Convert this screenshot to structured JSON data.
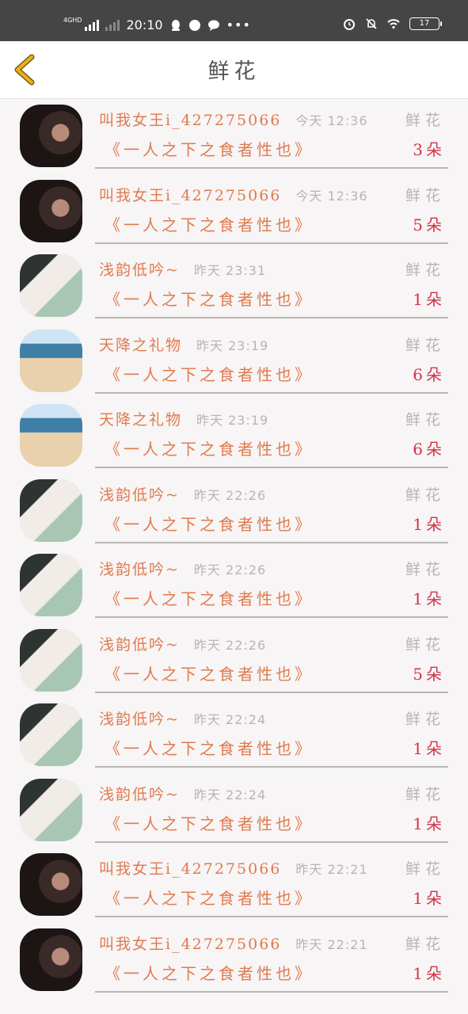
{
  "status_bar": {
    "network": "4GHD",
    "time": "20:10",
    "battery": "17"
  },
  "header": {
    "title": "鲜花"
  },
  "records": [
    {
      "avatar": "av-dark",
      "name": "叫我女王i_427275066",
      "time": "今天 12:36",
      "kind": "鲜花",
      "book": "《一人之下之食者性也》",
      "count": "3朵"
    },
    {
      "avatar": "av-dark",
      "name": "叫我女王i_427275066",
      "time": "今天 12:36",
      "kind": "鲜花",
      "book": "《一人之下之食者性也》",
      "count": "5朵"
    },
    {
      "avatar": "av-girl",
      "name": "浅韵低吟~",
      "time": "昨天 23:31",
      "kind": "鲜花",
      "book": "《一人之下之食者性也》",
      "count": "1朵"
    },
    {
      "avatar": "av-beach",
      "name": "天降之礼物",
      "time": "昨天 23:19",
      "kind": "鲜花",
      "book": "《一人之下之食者性也》",
      "count": "6朵"
    },
    {
      "avatar": "av-beach",
      "name": "天降之礼物",
      "time": "昨天 23:19",
      "kind": "鲜花",
      "book": "《一人之下之食者性也》",
      "count": "6朵"
    },
    {
      "avatar": "av-girl",
      "name": "浅韵低吟~",
      "time": "昨天 22:26",
      "kind": "鲜花",
      "book": "《一人之下之食者性也》",
      "count": "1朵"
    },
    {
      "avatar": "av-girl",
      "name": "浅韵低吟~",
      "time": "昨天 22:26",
      "kind": "鲜花",
      "book": "《一人之下之食者性也》",
      "count": "1朵"
    },
    {
      "avatar": "av-girl",
      "name": "浅韵低吟~",
      "time": "昨天 22:26",
      "kind": "鲜花",
      "book": "《一人之下之食者性也》",
      "count": "5朵"
    },
    {
      "avatar": "av-girl",
      "name": "浅韵低吟~",
      "time": "昨天 22:24",
      "kind": "鲜花",
      "book": "《一人之下之食者性也》",
      "count": "1朵"
    },
    {
      "avatar": "av-girl",
      "name": "浅韵低吟~",
      "time": "昨天 22:24",
      "kind": "鲜花",
      "book": "《一人之下之食者性也》",
      "count": "1朵"
    },
    {
      "avatar": "av-dark",
      "name": "叫我女王i_427275066",
      "time": "昨天 22:21",
      "kind": "鲜花",
      "book": "《一人之下之食者性也》",
      "count": "1朵"
    },
    {
      "avatar": "av-dark",
      "name": "叫我女王i_427275066",
      "time": "昨天 22:21",
      "kind": "鲜花",
      "book": "《一人之下之食者性也》",
      "count": "1朵"
    }
  ],
  "colors": {
    "accent": "#e07a4f",
    "count": "#d2344a",
    "muted": "#b8b4b2",
    "back_arrow": "#e8b21c"
  }
}
